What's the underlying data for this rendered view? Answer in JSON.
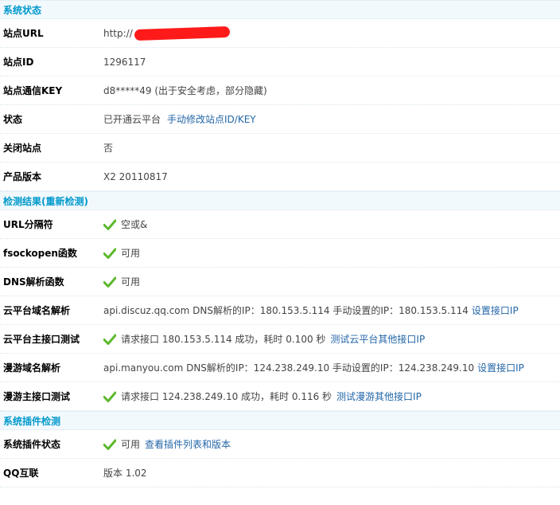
{
  "sections": {
    "status": {
      "title": "系统状态"
    },
    "check": {
      "title": "检测结果",
      "recheck_link": "(重新检测)"
    },
    "plugin": {
      "title": "系统插件检测"
    }
  },
  "status_rows": {
    "site_url": {
      "label": "站点URL",
      "value": "http://",
      "redacted": true
    },
    "site_id": {
      "label": "站点ID",
      "value": "1296117"
    },
    "site_key": {
      "label": "站点通信KEY",
      "value": "d8*****49 (出于安全考虑，部分隐藏)"
    },
    "state": {
      "label": "状态",
      "value": "已开通云平台",
      "link": "手动修改站点ID/KEY"
    },
    "closed": {
      "label": "关闭站点",
      "value": "否"
    },
    "version": {
      "label": "产品版本",
      "value": "X2 20110817"
    }
  },
  "check_rows": {
    "url_sep": {
      "label": "URL分隔符",
      "value": "空或&",
      "ok": true
    },
    "fsockopen": {
      "label": "fsockopen函数",
      "value": "可用",
      "ok": true
    },
    "dns_func": {
      "label": "DNS解析函数",
      "value": "可用",
      "ok": true
    },
    "cloud_dns": {
      "label": "云平台域名解析",
      "value": "api.discuz.qq.com DNS解析的IP：180.153.5.114 手动设置的IP：180.153.5.114",
      "link": "设置接口IP"
    },
    "cloud_main": {
      "label": "云平台主接口测试",
      "value": "请求接口  180.153.5.114 成功，耗时  0.100 秒",
      "link": "测试云平台其他接口IP",
      "ok": true
    },
    "manyou_dns": {
      "label": "漫游域名解析",
      "value": "api.manyou.com DNS解析的IP：124.238.249.10 手动设置的IP：124.238.249.10",
      "link": "设置接口IP"
    },
    "manyou_main": {
      "label": "漫游主接口测试",
      "value": "请求接口  124.238.249.10 成功，耗时  0.116 秒",
      "link": "测试漫游其他接口IP",
      "ok": true
    }
  },
  "plugin_rows": {
    "plugin_status": {
      "label": "系统插件状态",
      "value": "可用",
      "link": "查看插件列表和版本",
      "ok": true
    },
    "qq_connect": {
      "label": "QQ互联",
      "value": "版本  1.02"
    }
  },
  "colors": {
    "check": "#5cb82d",
    "link": "#2366a8",
    "section_title": "#0099cc",
    "section_bg": "#f2f9fd"
  }
}
